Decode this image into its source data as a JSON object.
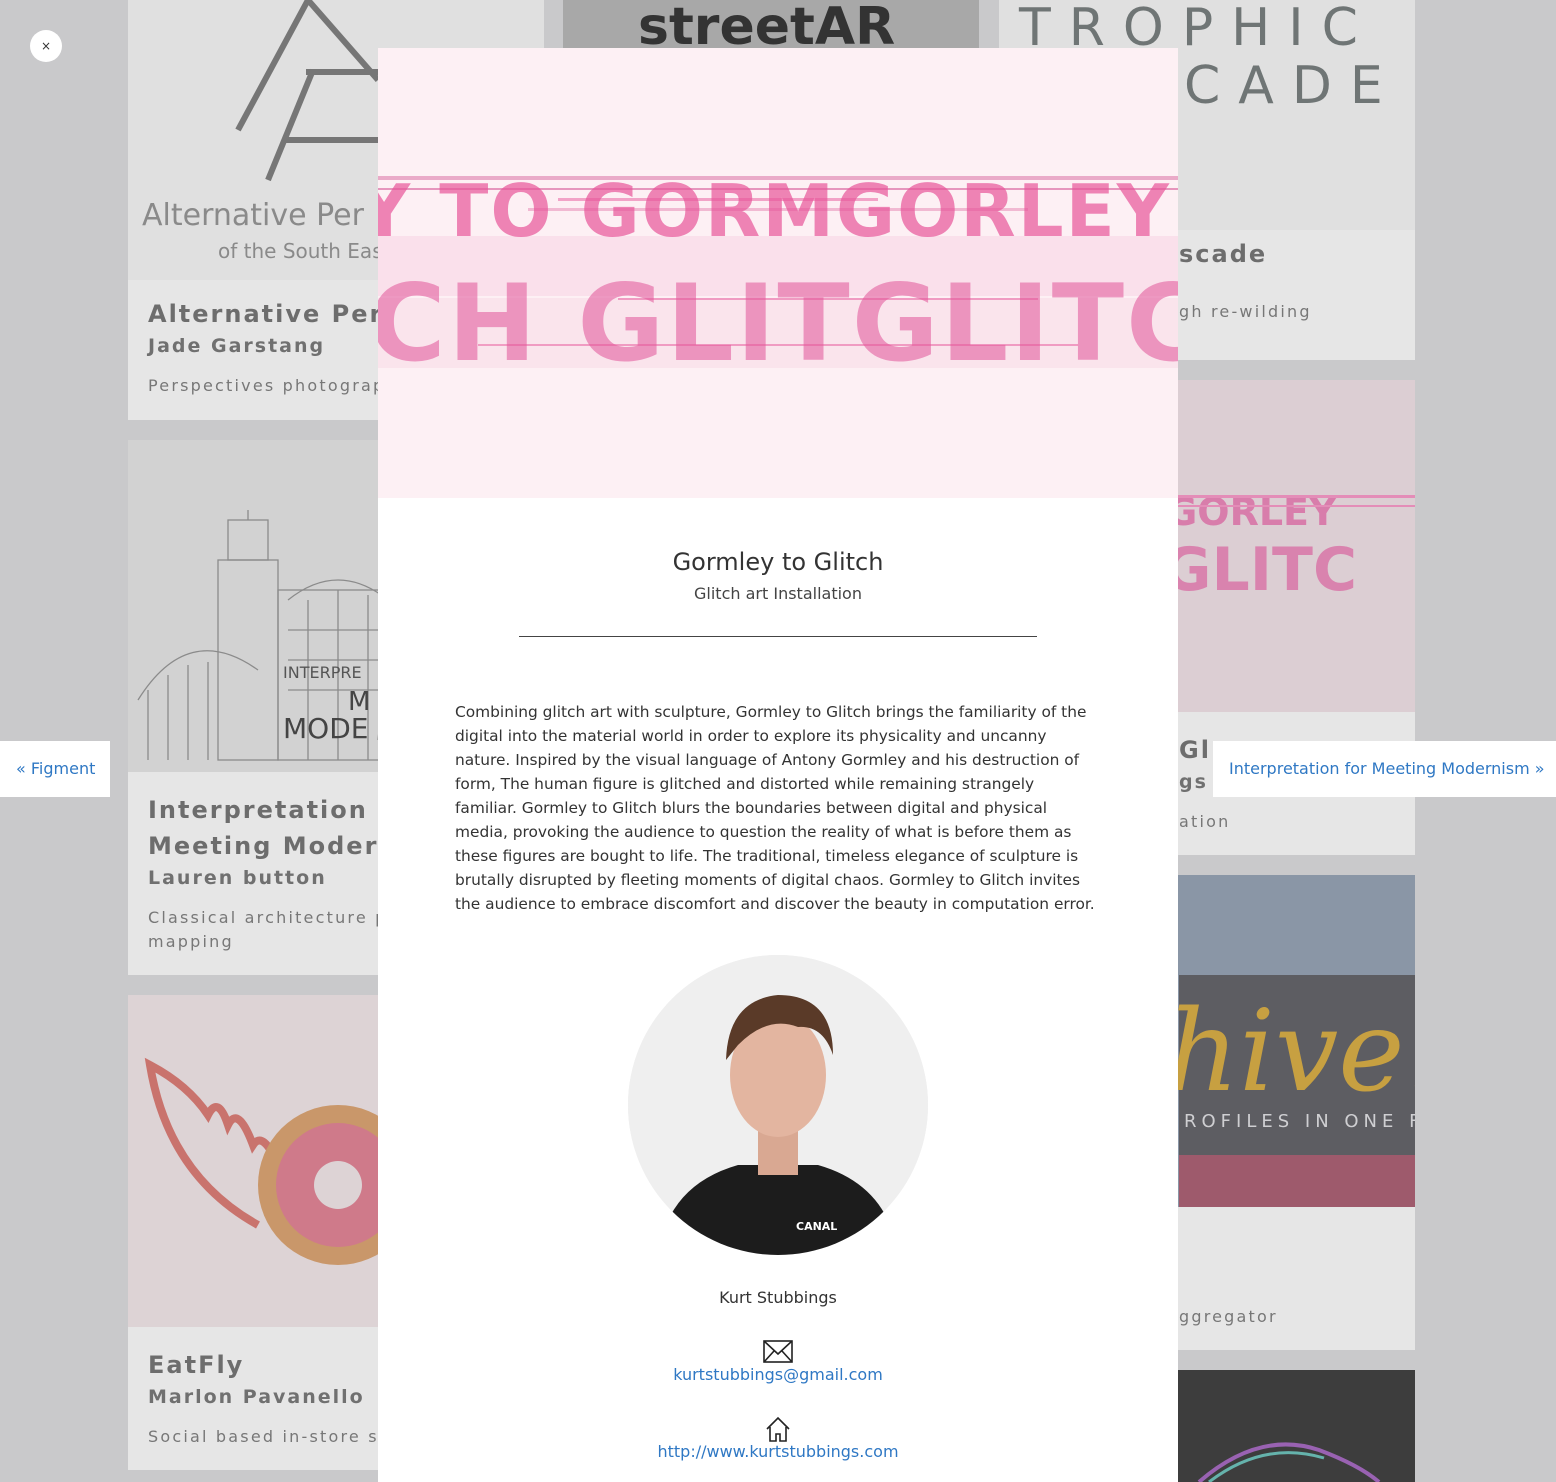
{
  "gallery": {
    "cards": [
      {
        "title": "Alternative Pers",
        "author": "Jade Garstang",
        "description": "Perspectives photograp",
        "logo_text_line1": "Alternative Per",
        "logo_text_line2": "of the South Eas"
      },
      {
        "title_line1": "Interpretation fo",
        "title_line2": "Meeting Modern",
        "author": "Lauren button",
        "description_line1": "Classical architecture p",
        "description_line2": "mapping",
        "thumb_text1": "INTERPRE",
        "thumb_text2": "M",
        "thumb_text3": "MODE"
      },
      {
        "title": "EatFly",
        "author": "Marlon Pavanello",
        "description": "Social based in-store sh"
      },
      {
        "thumb_text": "streetAR"
      },
      {
        "thumb_text1": "TROPHIC",
        "thumb_text2": "CADE",
        "title": "scade",
        "description": "gh re-wilding"
      },
      {
        "thumb_text1": "RMGORLEY",
        "thumb_text2": "ITGLITC",
        "title": "Gl",
        "author": "gs",
        "description": "ation"
      },
      {
        "thumb_text1": "hive.",
        "thumb_text2": "ROFILES IN ONE FEED",
        "description": "ggregator"
      }
    ]
  },
  "overlay": {
    "close_label": "×",
    "prev_label": "« Figment",
    "next_label": "Interpretation for Meeting Modernism »"
  },
  "project": {
    "hero_text_line1": "Y TO GORMGORLEY",
    "hero_text_line2": "CH GLITGLITC",
    "title": "Gormley to Glitch",
    "subtitle": "Glitch art Installation",
    "description": "Combining glitch art with sculpture, Gormley to Glitch brings the familiarity of the digital into the material world in order to explore its physicality and uncanny nature. Inspired by the visual language of Antony Gormley and his destruction of form, The human figure is glitched and distorted while remaining strangely familiar. Gormley to Glitch blurs the boundaries between digital and physical media, provoking the audience to question the reality of what is before them as these figures are bought to life. The traditional, timeless elegance of sculpture is brutally disrupted by fleeting moments of digital chaos. Gormley to Glitch invites the audience to embrace discomfort and discover the beauty in computation error.",
    "avatar_shirt_text": "CANAL",
    "person_name": "Kurt Stubbings",
    "email": "kurtstubbings@gmail.com",
    "website": "http://www.kurtstubbings.com",
    "email_icon": "envelope-icon",
    "website_icon": "home-icon"
  },
  "colors": {
    "link": "#2f78c4",
    "hero_bg": "#fdf0f4",
    "glitch_pink": "#e8559a",
    "overlay_bg": "#c9c9cb"
  }
}
